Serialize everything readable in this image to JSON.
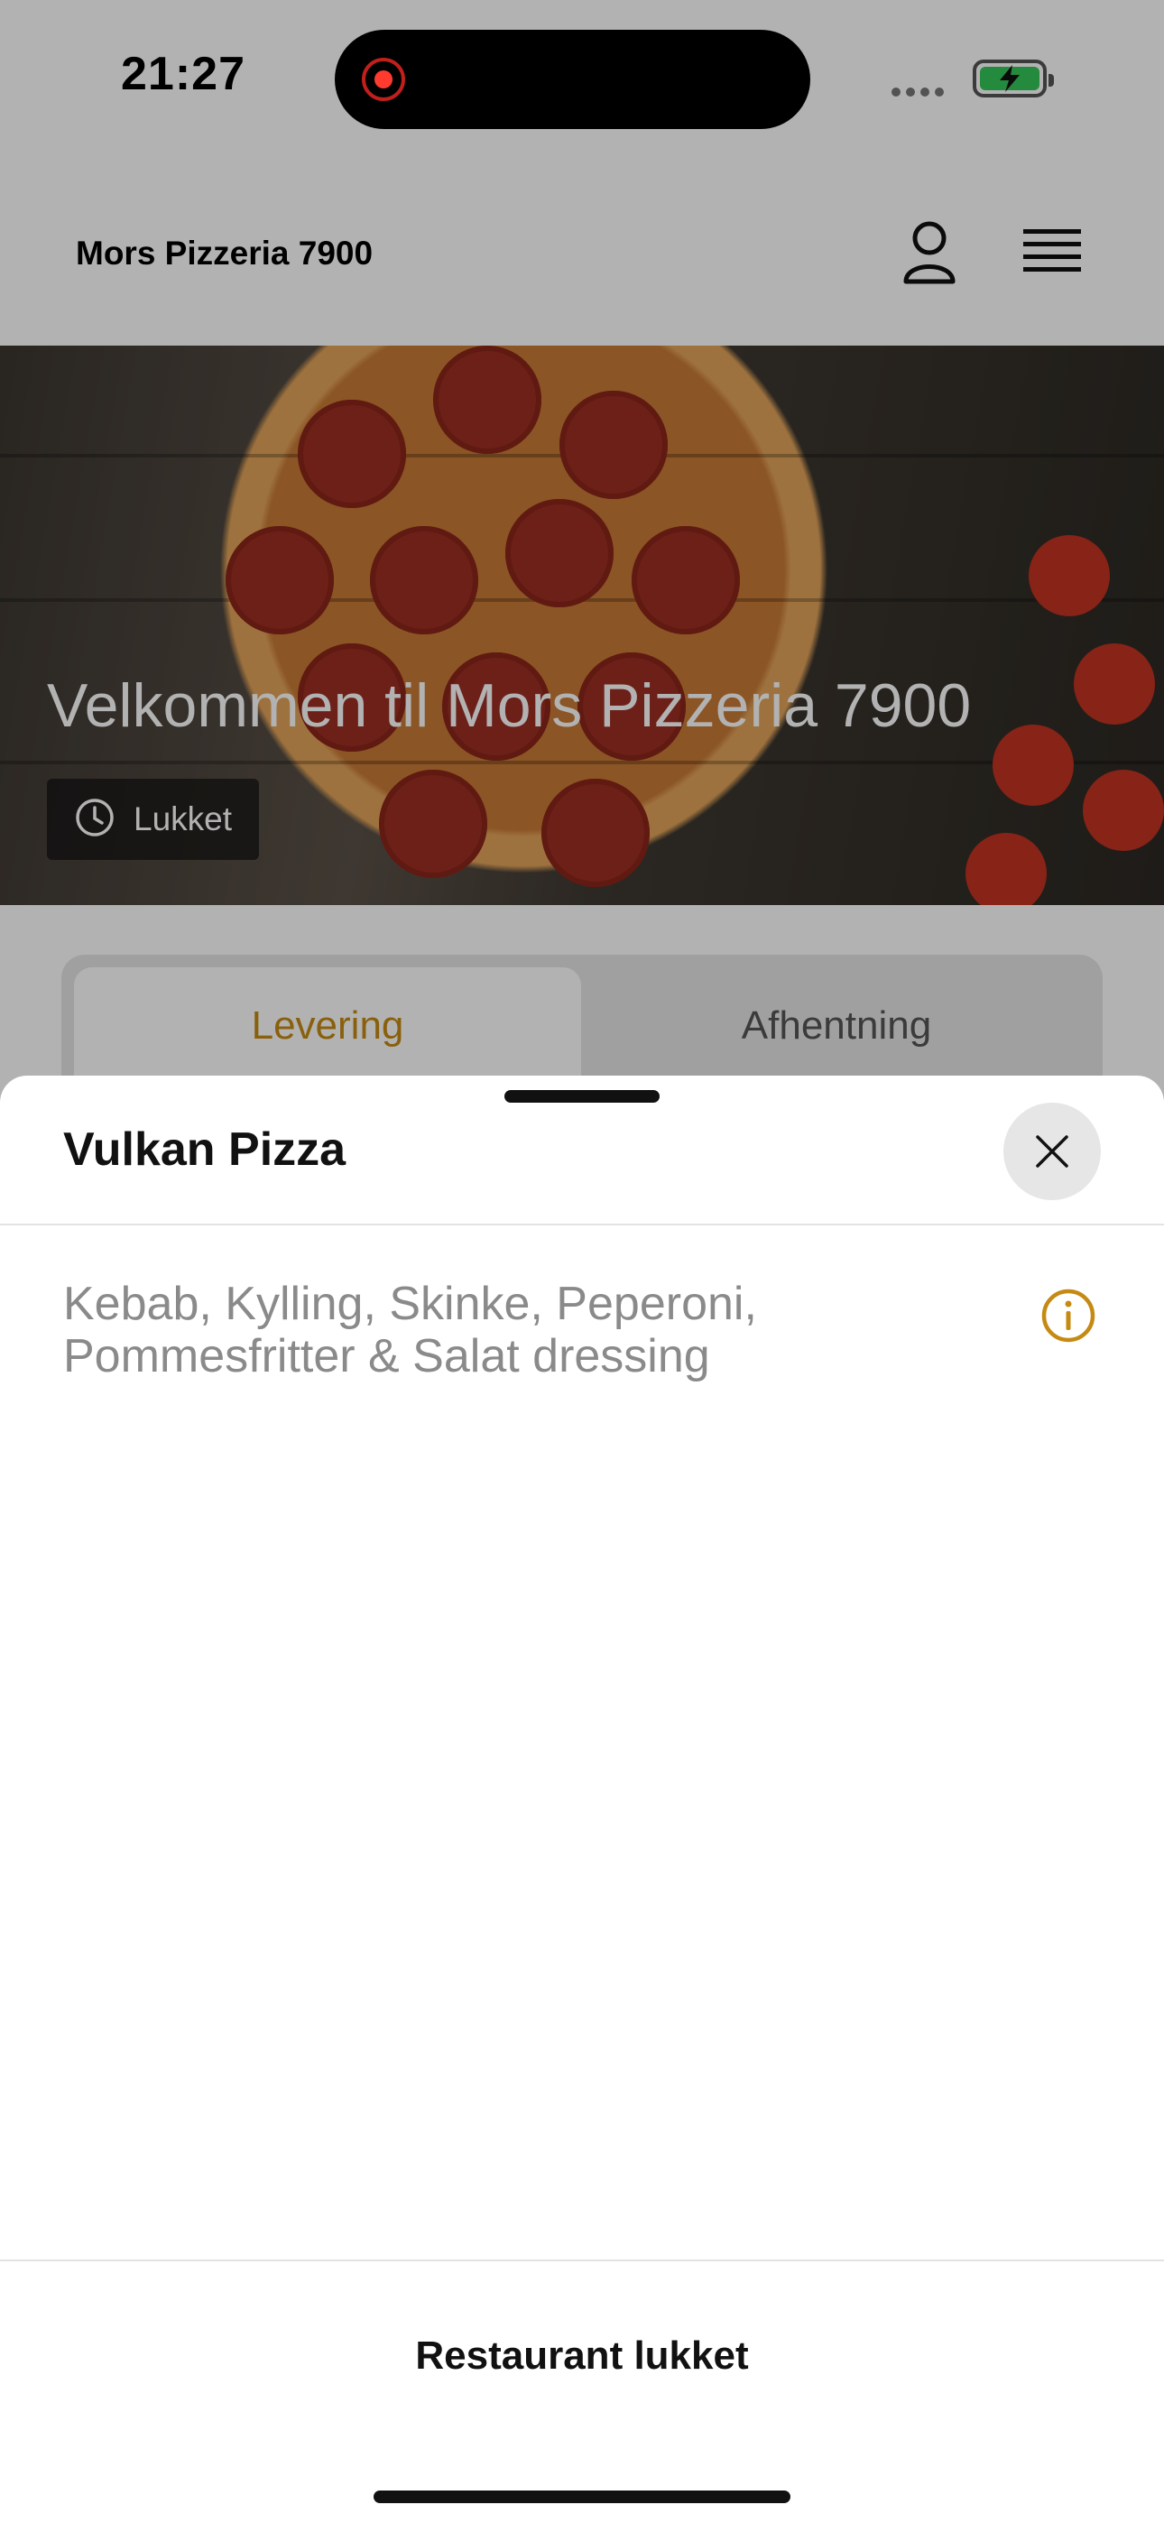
{
  "status_bar": {
    "time": "21:27"
  },
  "header": {
    "restaurant_name": "Mors Pizzeria 7900"
  },
  "hero": {
    "title": "Velkommen til Mors Pizzeria 7900",
    "status_label": "Lukket"
  },
  "tabs": [
    {
      "label": "Levering",
      "active": true
    },
    {
      "label": "Afhentning",
      "active": false
    }
  ],
  "sheet": {
    "title": "Vulkan Pizza",
    "description": "Kebab, Kylling, Skinke, Peperoni, Pommesfritter & Salat dressing",
    "footer_label": "Restaurant lukket"
  },
  "colors": {
    "accent": "#c58a14",
    "battery": "#34c759",
    "record": "#ff3b30"
  },
  "icons": [
    "record-icon",
    "battery-icon",
    "user-icon",
    "menu-icon",
    "clock-icon",
    "close-icon",
    "info-icon"
  ]
}
